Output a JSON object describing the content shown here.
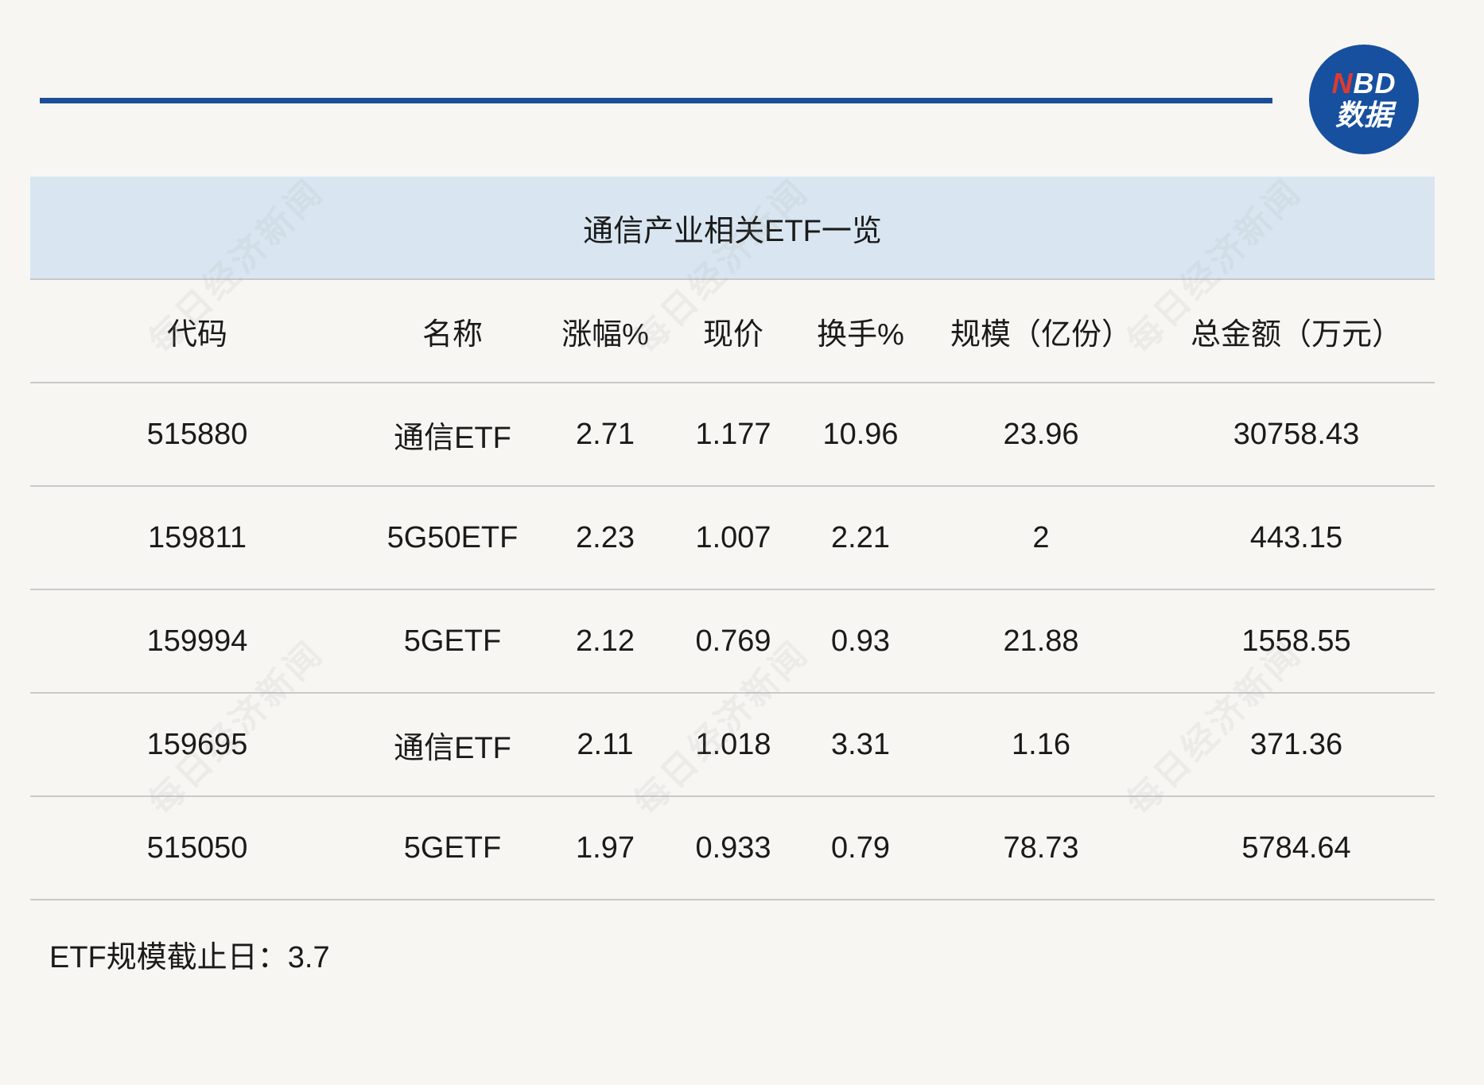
{
  "logo": {
    "line1_n": "N",
    "line1_rest": "BD",
    "line2": "数据"
  },
  "watermark_text": "每日经济新闻",
  "table": {
    "title": "通信产业相关ETF一览",
    "headers": [
      "代码",
      "名称",
      "涨幅%",
      "现价",
      "换手%",
      "规模（亿份）",
      "总金额（万元）"
    ],
    "rows": [
      [
        "515880",
        "通信ETF",
        "2.71",
        "1.177",
        "10.96",
        "23.96",
        "30758.43"
      ],
      [
        "159811",
        "5G50ETF",
        "2.23",
        "1.007",
        "2.21",
        "2",
        "443.15"
      ],
      [
        "159994",
        "5GETF",
        "2.12",
        "0.769",
        "0.93",
        "21.88",
        "1558.55"
      ],
      [
        "159695",
        "通信ETF",
        "2.11",
        "1.018",
        "3.31",
        "1.16",
        "371.36"
      ],
      [
        "515050",
        "5GETF",
        "1.97",
        "0.933",
        "0.79",
        "78.73",
        "5784.64"
      ]
    ]
  },
  "footnote": "ETF规模截止日：3.7"
}
